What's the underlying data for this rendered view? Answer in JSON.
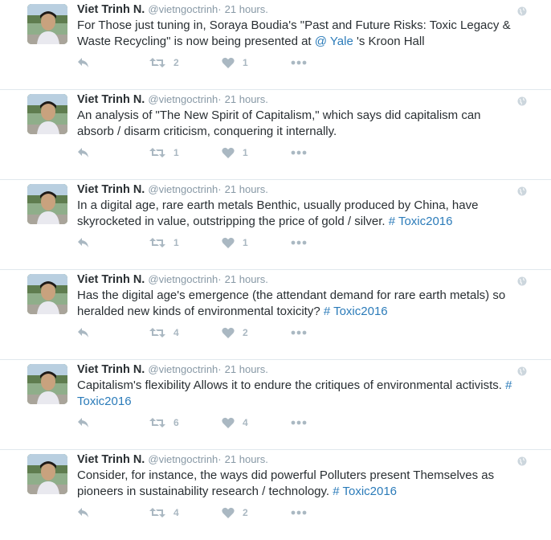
{
  "tweets": [
    {
      "fullname": "Viet Trinh N.",
      "username": "@vietngoctrinh",
      "separator": "·",
      "time": "21 hours.",
      "segments": [
        {
          "text": "For Those just tuning in, Soraya Boudia's \"Past and Future Risks: Toxic Legacy & Waste Recycling\" is now being presented at ",
          "link": false
        },
        {
          "text": "@ Yale",
          "link": true
        },
        {
          "text": " 's Kroon Hall",
          "link": false
        }
      ],
      "retweets": "2",
      "likes": "1"
    },
    {
      "fullname": "Viet Trinh N.",
      "username": "@vietngoctrinh",
      "separator": "·",
      "time": "21 hours.",
      "segments": [
        {
          "text": "An analysis of \"The New Spirit of Capitalism,\" which says did capitalism can absorb / disarm criticism, conquering it internally.",
          "link": false
        }
      ],
      "retweets": "1",
      "likes": "1"
    },
    {
      "fullname": "Viet Trinh N.",
      "username": "@vietngoctrinh",
      "separator": "·",
      "time": "21 hours.",
      "segments": [
        {
          "text": "In a digital age, rare earth metals Benthic, usually produced by China, have skyrocketed in value, outstripping the price of gold / silver. ",
          "link": false
        },
        {
          "text": "# Toxic2016",
          "link": true
        }
      ],
      "retweets": "1",
      "likes": "1"
    },
    {
      "fullname": "Viet Trinh N.",
      "username": "@vietngoctrinh",
      "separator": "·",
      "time": "21 hours.",
      "segments": [
        {
          "text": "Has the digital age's emergence (the attendant demand for rare earth metals) so heralded new kinds of environmental toxicity? ",
          "link": false
        },
        {
          "text": "# Toxic2016",
          "link": true
        }
      ],
      "retweets": "4",
      "likes": "2"
    },
    {
      "fullname": "Viet Trinh N.",
      "username": "@vietngoctrinh",
      "separator": "·",
      "time": "21 hours.",
      "segments": [
        {
          "text": "Capitalism's flexibility Allows it to endure the critiques of environmental activists. ",
          "link": false
        },
        {
          "text": "# Toxic2016",
          "link": true
        }
      ],
      "retweets": "6",
      "likes": "4"
    },
    {
      "fullname": "Viet Trinh N.",
      "username": "@vietngoctrinh",
      "separator": "·",
      "time": "21 hours.",
      "segments": [
        {
          "text": "Consider, for instance, the ways did powerful Polluters present Themselves as pioneers in sustainability research / technology. ",
          "link": false
        },
        {
          "text": "# Toxic2016",
          "link": true
        }
      ],
      "retweets": "4",
      "likes": "2"
    }
  ],
  "icons": {
    "reply": "reply-icon",
    "retweet": "retweet-icon",
    "like": "heart-icon",
    "more": "more-icon",
    "globe": "globe-icon"
  },
  "colors": {
    "link": "#2b7bb9",
    "muted": "#8899a6",
    "action": "#aab8c2",
    "divider": "#e1e8ed"
  }
}
